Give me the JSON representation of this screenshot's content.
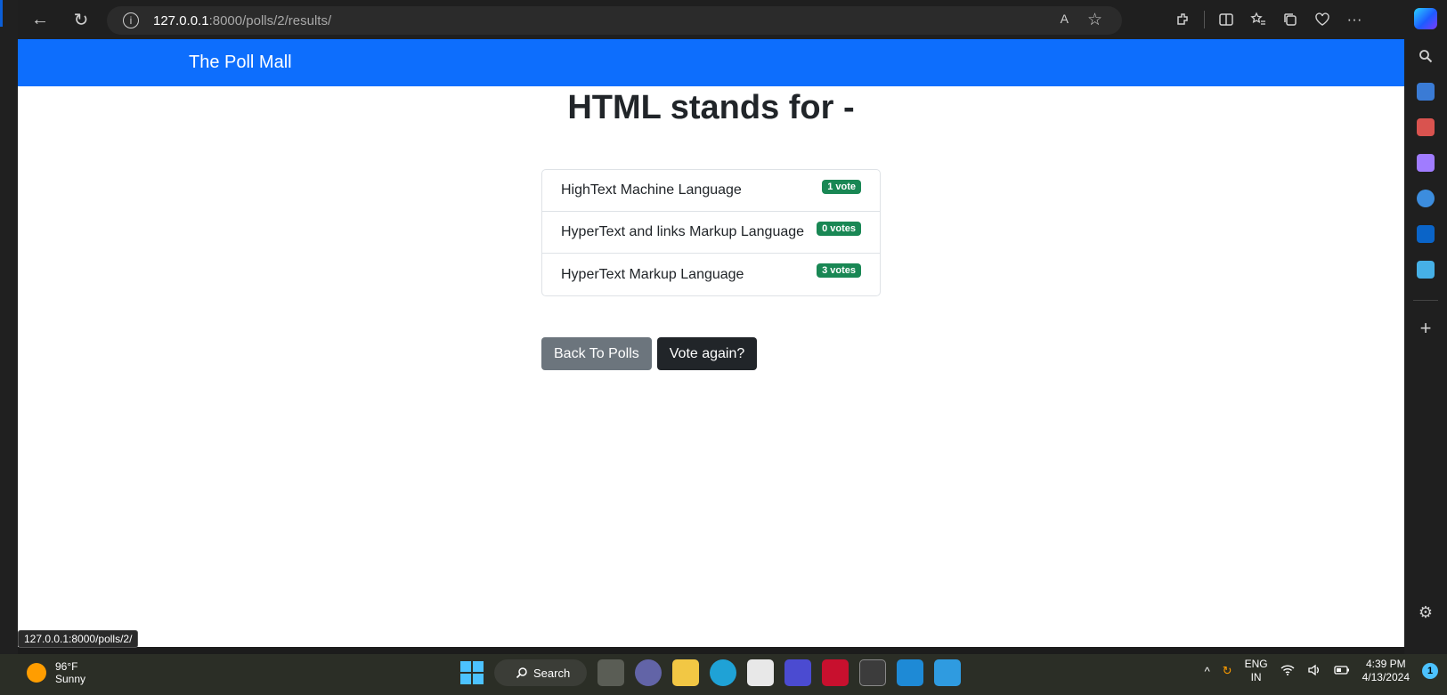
{
  "browser": {
    "url_host": "127.0.0.1",
    "url_path": ":8000/polls/2/results/",
    "back_glyph": "←",
    "reload_glyph": "↻",
    "info_glyph": "i",
    "read_aloud_glyph": "A",
    "favorite_glyph": "☆",
    "more_glyph": "···",
    "status_url": "127.0.0.1:8000/polls/2/"
  },
  "site": {
    "brand": "The Poll Mall"
  },
  "poll": {
    "question": "HTML stands for -",
    "choices": [
      {
        "label": "HighText Machine Language",
        "votes": "1 vote"
      },
      {
        "label": "HyperText and links Markup Language",
        "votes": "0 votes"
      },
      {
        "label": "HyperText Markup Language",
        "votes": "3 votes"
      }
    ],
    "badge_color": "#198754"
  },
  "actions": {
    "back_label": "Back To Polls",
    "vote_again_label": "Vote again?"
  },
  "taskbar": {
    "temperature": "96°F",
    "condition": "Sunny",
    "search_label": "Search",
    "lang_line1": "ENG",
    "lang_line2": "IN",
    "time": "4:39 PM",
    "date": "4/13/2024",
    "notification_count": "1"
  },
  "sidebar": {
    "plus_glyph": "+",
    "gear_glyph": "⚙"
  },
  "colors": {
    "navbar": "#0d6efd",
    "secondary_button": "#6c757d",
    "dark_button": "#212529"
  }
}
